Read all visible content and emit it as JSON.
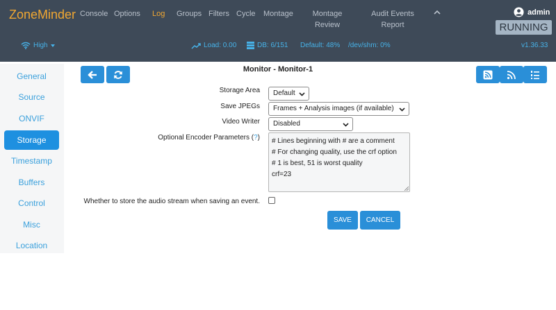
{
  "app": {
    "brand": "ZoneMinder",
    "user": "admin",
    "state": "RUNNING",
    "version": "v1.36.33"
  },
  "nav": {
    "items": [
      "Console",
      "Options",
      "Log",
      "Groups",
      "Filters",
      "Cycle",
      "Montage"
    ],
    "montage_review": [
      "Montage",
      "Review"
    ],
    "audit_events": [
      "Audit Events",
      "Report"
    ],
    "active": "Log"
  },
  "status": {
    "bandwidth": "High",
    "load": "Load: 0.00",
    "db": "DB: 6/151",
    "storage": "Default: 48%",
    "shm": "/dev/shm: 0%"
  },
  "sidebar": {
    "items": [
      "General",
      "Source",
      "ONVIF",
      "Storage",
      "Timestamp",
      "Buffers",
      "Control",
      "Misc",
      "Location"
    ],
    "active": "Storage"
  },
  "page": {
    "title": "Monitor - Monitor-1"
  },
  "form": {
    "storage_area": {
      "label": "Storage Area",
      "value": "Default"
    },
    "save_jpegs": {
      "label": "Save JPEGs",
      "value": "Frames + Analysis images (if available)"
    },
    "video_writer": {
      "label": "Video Writer",
      "value": "Disabled"
    },
    "encoder_params": {
      "label": "Optional Encoder Parameters",
      "help": "?",
      "lines": [
        "# Lines beginning with # are a comment",
        "# For changing quality, use the crf option",
        "# 1 is best, 51 is worst quality",
        "crf=23"
      ]
    },
    "audio": {
      "label": "Whether to store the audio stream when saving an event.",
      "checked": false
    },
    "save_label": "SAVE",
    "cancel_label": "CANCEL"
  },
  "colors": {
    "navbar": "#3e4a58",
    "accent": "#2a8fd8",
    "brand": "#f0a732"
  }
}
